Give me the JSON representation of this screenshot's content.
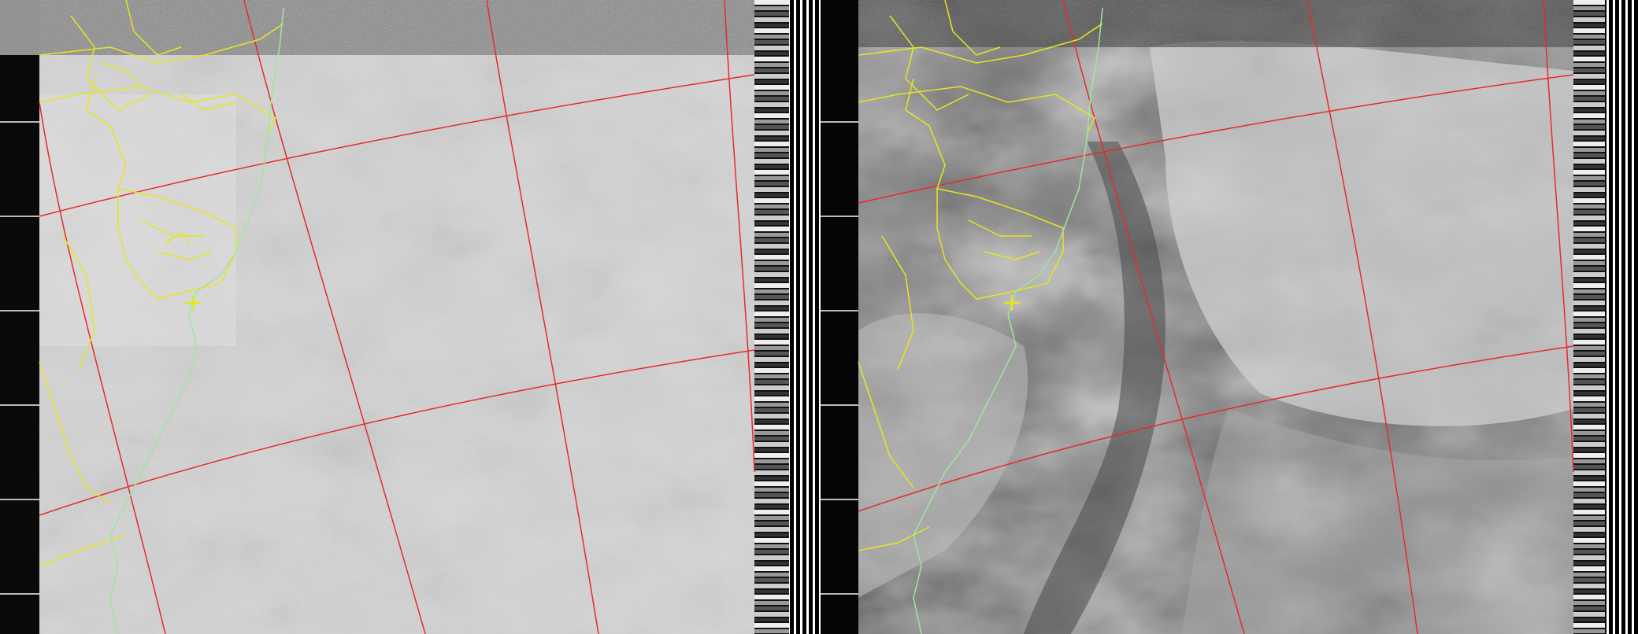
{
  "image": {
    "kind": "apt-satellite-image",
    "channels": [
      {
        "id": "A",
        "label": "",
        "tone": "visible",
        "land_overlay": "yellow",
        "coast_overlay": "light-green"
      },
      {
        "id": "B",
        "label": "",
        "tone": "infrared",
        "land_overlay": "yellow",
        "coast_overlay": "light-green"
      }
    ],
    "colors": {
      "graticule": "#e82a2a",
      "borders": "#e6e61e",
      "coastline": "#9ee69e",
      "background": "#000000",
      "channel_a_base": "#d9d9d9",
      "channel_b_base": "#7a7a7a"
    },
    "markers": [
      {
        "name": "station-marker",
        "glyph": "+"
      }
    ]
  }
}
